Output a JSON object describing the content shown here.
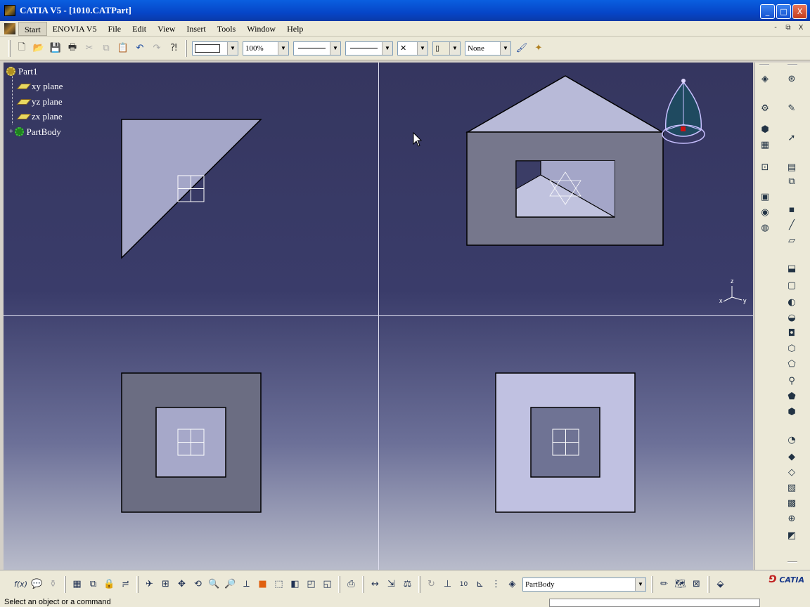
{
  "window": {
    "title": "CATIA V5 - [1010.CATPart]",
    "controls": [
      "_",
      "□",
      "X"
    ]
  },
  "menubar": {
    "items": [
      "Start",
      "ENOVIA V5",
      "File",
      "Edit",
      "View",
      "Insert",
      "Tools",
      "Window",
      "Help"
    ],
    "mdi_controls": [
      "-",
      "⧉",
      "X"
    ]
  },
  "toolbar": {
    "zoom_value": "100%",
    "layer_value": "None"
  },
  "tree": {
    "root": "Part1",
    "items": [
      "xy plane",
      "yz plane",
      "zx plane",
      "PartBody"
    ]
  },
  "compass_axes": {
    "z": "z",
    "x": "x",
    "y": "y"
  },
  "bottom_toolbar": {
    "current_body": "PartBody",
    "formula_label": "f(x)"
  },
  "status": {
    "text": "Select an object or a command"
  },
  "brand": {
    "logo_text": "CATIA",
    "accent": "#0a5fe0",
    "viewport_top": "#35365f",
    "viewport_bottom": "#b9bccb"
  }
}
